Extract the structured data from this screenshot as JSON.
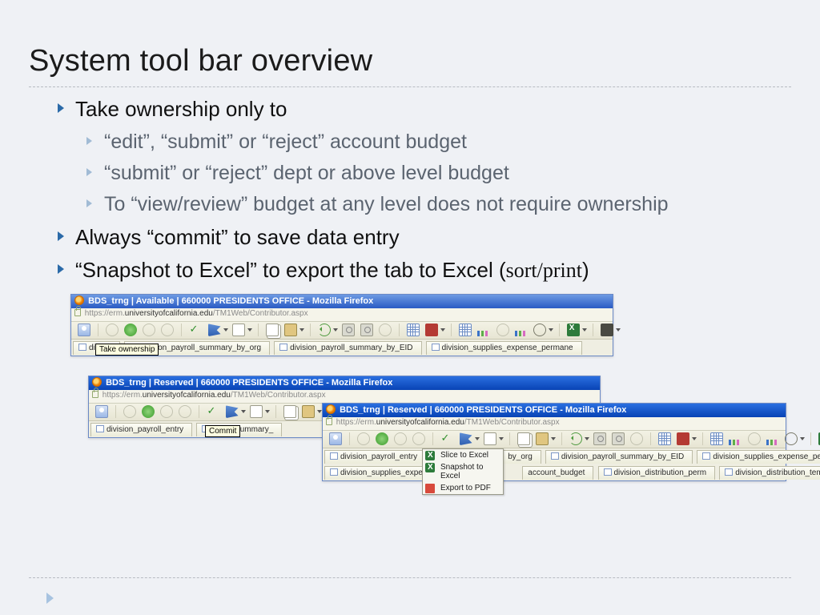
{
  "slide": {
    "title": "System tool bar overview",
    "bullets": {
      "b1a": "Take ownership only to",
      "b1a_sub": {
        "s1": "“edit”, “submit” or “reject” account budget",
        "s2": "“submit” or “reject” dept or above level budget",
        "s3": "To “view/review” budget at any level does not require ownership"
      },
      "b1b": "Always “commit” to save data entry",
      "b1c_pre": "“Snapshot to Excel” to export the tab to Excel (",
      "b1c_sp": "sort/print",
      "b1c_post": ")"
    }
  },
  "win1": {
    "title": "BDS_trng | Available | 660000 PRESIDENTS OFFICE - Mozilla Firefox",
    "url_host": "universityofcalifornia.edu",
    "url_pre": "https://erm.",
    "url_post": "/TM1Web/Contributor.aspx",
    "tooltip": "Take ownership",
    "tabs": {
      "t0": "divisio",
      "t1": "division_payroll_summary_by_org",
      "t2": "division_payroll_summary_by_EID",
      "t3": "division_supplies_expense_permane"
    }
  },
  "win2": {
    "title": "BDS_trng | Reserved | 660000 PRESIDENTS OFFICE - Mozilla Firefox",
    "url_host": "universityofcalifornia.edu",
    "url_pre": "https://erm.",
    "url_post": "/TM1Web/Contributor.aspx",
    "tooltip": "Commit",
    "tabs": {
      "t0": "division_payroll_entry",
      "t1": "ayroll_summary_"
    }
  },
  "win3": {
    "title": "BDS_trng | Reserved | 660000 PRESIDENTS OFFICE - Mozilla Firefox",
    "url_host": "universityofcalifornia.edu",
    "url_pre": "https://erm.",
    "url_post": "/TM1Web/Contributor.aspx",
    "menu": {
      "m1": "Slice to Excel",
      "m2": "Snapshot to Excel",
      "m3": "Export to PDF"
    },
    "tabs_row1": {
      "t0": "division_payroll_entry",
      "t1": "by_org",
      "t2": "division_payroll_summary_by_EID",
      "t3": "division_supplies_expense_permar"
    },
    "tabs_row2": {
      "t0": "division_supplies_expense_tem",
      "t1": "account_budget",
      "t2": "division_distribution_perm",
      "t3": "division_distribution_temp"
    }
  }
}
